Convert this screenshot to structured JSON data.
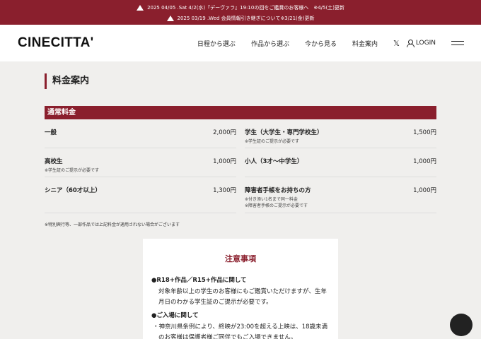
{
  "notices": [
    "2025 04/05 .Sat 4/2(水)『デーヴァラ』19:10の回をご鑑賞のお客様へ　※4/5(土)更新",
    "2025 03/19 .Wed 会員情報引き継ぎについて※3/21(金)更新"
  ],
  "header": {
    "logo": "CINECITTA'",
    "nav": [
      "日程から選ぶ",
      "作品から選ぶ",
      "今から見る",
      "料金案内"
    ],
    "x_icon": "𝕏",
    "login": "LOGIN"
  },
  "page": {
    "title": "料金案内",
    "section": "通常料金",
    "prices": [
      {
        "label": "一般",
        "price": "2,000円",
        "notes": []
      },
      {
        "label": "学生（大学生・専門学校生）",
        "price": "1,500円",
        "notes": [
          "※学生証のご提示が必要です"
        ]
      },
      {
        "label": "高校生",
        "price": "1,000円",
        "notes": [
          "※学生証のご提示が必要です"
        ]
      },
      {
        "label": "小人（3才～中学生）",
        "price": "1,000円",
        "notes": []
      },
      {
        "label": "シニア（60才以上）",
        "price": "1,300円",
        "notes": []
      },
      {
        "label": "障害者手帳をお持ちの方",
        "price": "1,000円",
        "notes": [
          "※付き添い1名まで同一料金",
          "※障害者手帳のご提示が必要です"
        ]
      }
    ],
    "footnote": "※特別興行等、一部作品では上記料金が適用されない場合がございます"
  },
  "card": {
    "title": "注意事項",
    "h1": "●R18+作品／R15+作品に関して",
    "p1": "対象年齢以上の学生のお客様にもご鑑賞いただけますが、生年月日のわかる学生証のご提示が必要です。",
    "h2": "●ご入場に関して",
    "li1": "・神奈川県条例により、終映が23:00を超える上映は、18歳未満のお客様は保護者様ご同伴でもご入場できません。"
  },
  "colors": {
    "accent": "#8a1f2d",
    "background": "#f0efed"
  }
}
